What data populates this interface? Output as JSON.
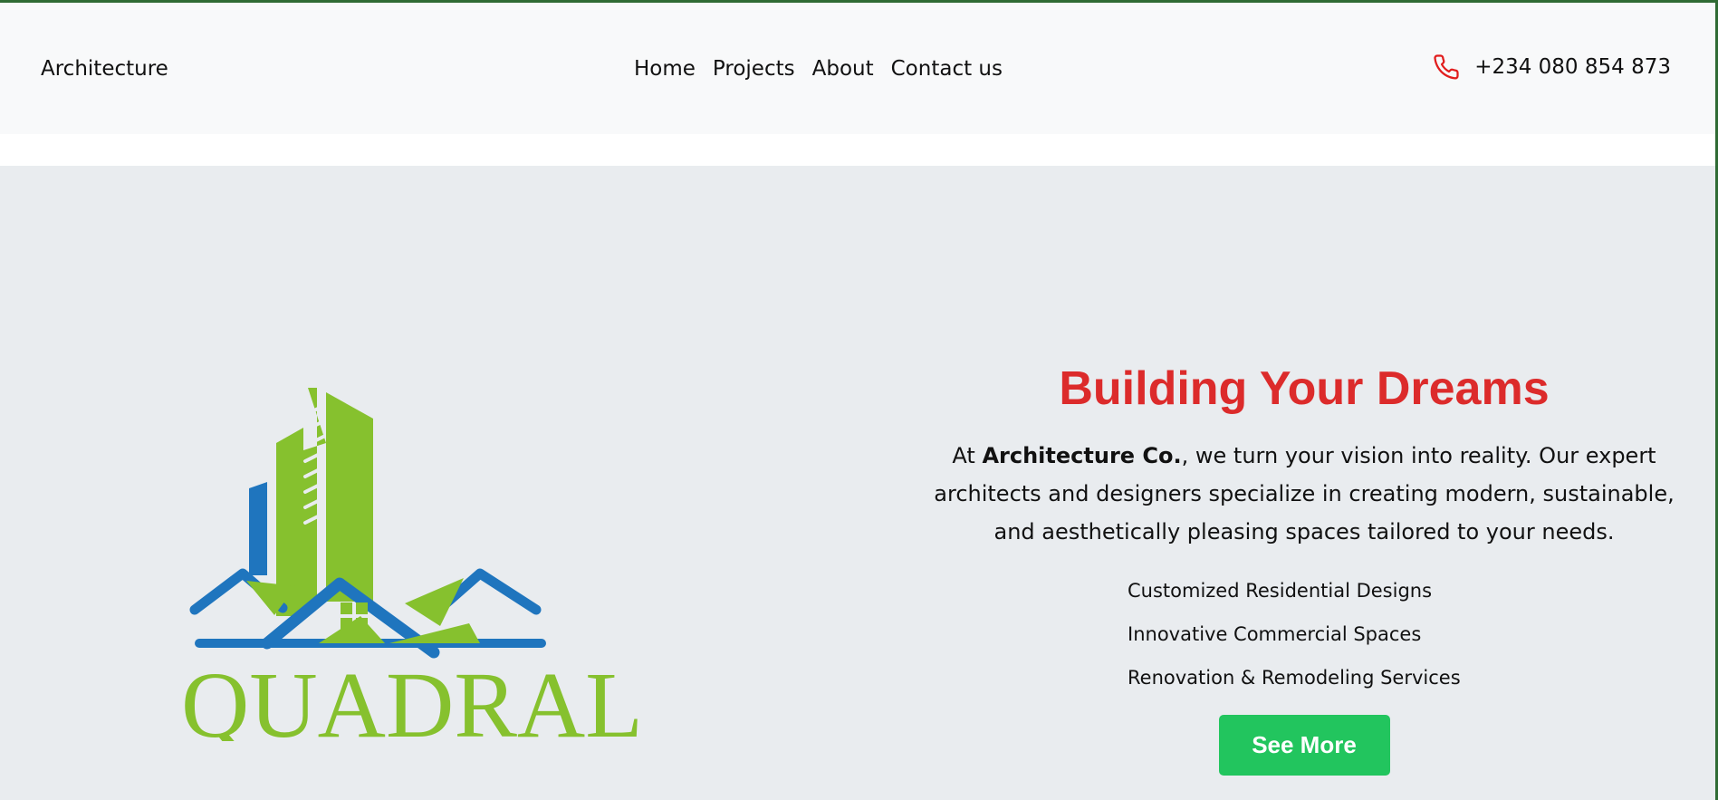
{
  "nav": {
    "brand": "Architecture",
    "links": [
      "Home",
      "Projects",
      "About",
      "Contact us"
    ],
    "phone": "+234 080 854 873"
  },
  "hero": {
    "logo_text": "QUADRAL",
    "title": "Building Your Dreams",
    "intro": "At",
    "company": "Architecture Co.",
    "description": ", we turn your vision into reality. Our expert architects and designers specialize in creating modern, sustainable, and aesthetically pleasing spaces tailored to your needs.",
    "features": [
      "Customized Residential Designs",
      "Innovative Commercial Spaces",
      "Renovation & Remodeling Services"
    ],
    "button_label": "See More"
  },
  "colors": {
    "accent_red": "#dc2b2b",
    "cta_green": "#22c55e",
    "logo_green": "#86c12e",
    "logo_blue": "#1f75be"
  },
  "icons": {
    "phone": "phone-icon"
  }
}
